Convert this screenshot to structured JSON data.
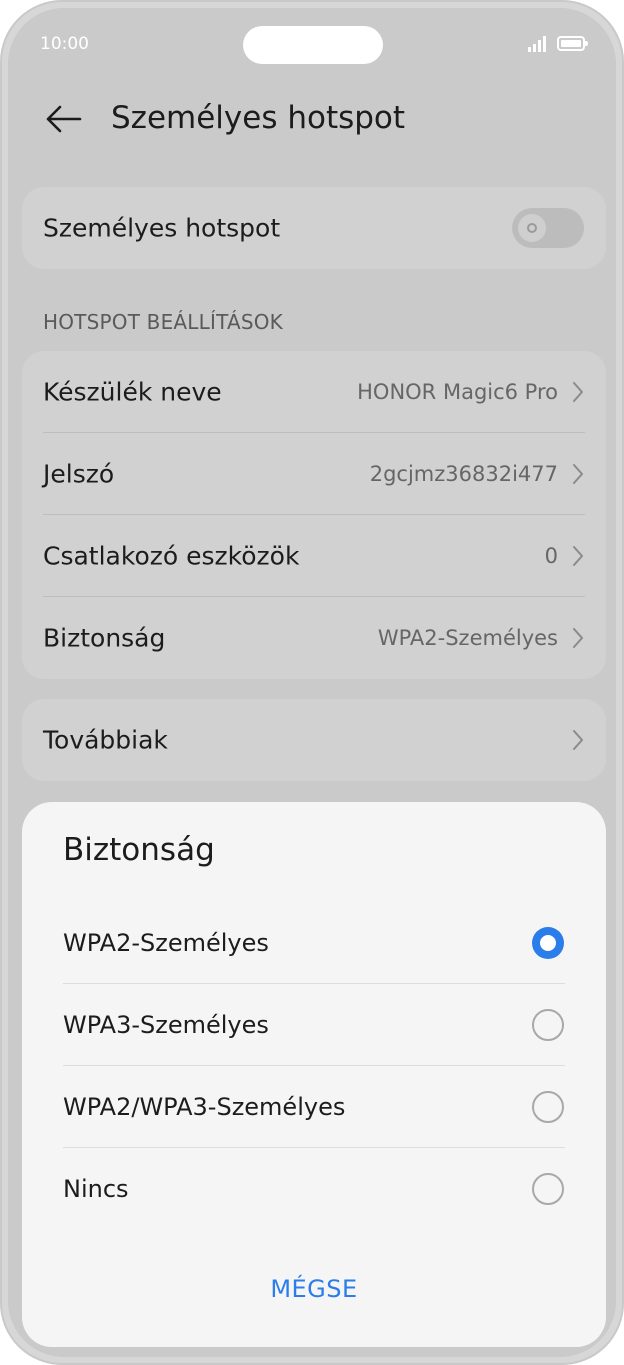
{
  "status_bar": {
    "time": "10:00",
    "icons": [
      "signal-icon",
      "battery-icon"
    ]
  },
  "header": {
    "title": "Személyes hotspot",
    "back_icon": "arrow-left-icon"
  },
  "hotspot_toggle": {
    "label": "Személyes hotspot",
    "enabled": false
  },
  "settings_section": {
    "header": "HOTSPOT BEÁLLÍTÁSOK",
    "items": [
      {
        "label": "Készülék neve",
        "value": "HONOR Magic6 Pro"
      },
      {
        "label": "Jelszó",
        "value": "2gcjmz36832i477"
      },
      {
        "label": "Csatlakozó eszközök",
        "value": "0"
      },
      {
        "label": "Biztonság",
        "value": "WPA2-Személyes"
      }
    ]
  },
  "more": {
    "label": "Továbbiak"
  },
  "security_sheet": {
    "title": "Biztonság",
    "options": [
      {
        "label": "WPA2-Személyes",
        "selected": true
      },
      {
        "label": "WPA3-Személyes",
        "selected": false
      },
      {
        "label": "WPA2/WPA3-Személyes",
        "selected": false
      },
      {
        "label": "Nincs",
        "selected": false
      }
    ],
    "cancel_label": "MÉGSE"
  },
  "colors": {
    "accent": "#2b7de9",
    "sheet_background": "#f5f5f5",
    "dimmed_background": "#cacaca"
  }
}
